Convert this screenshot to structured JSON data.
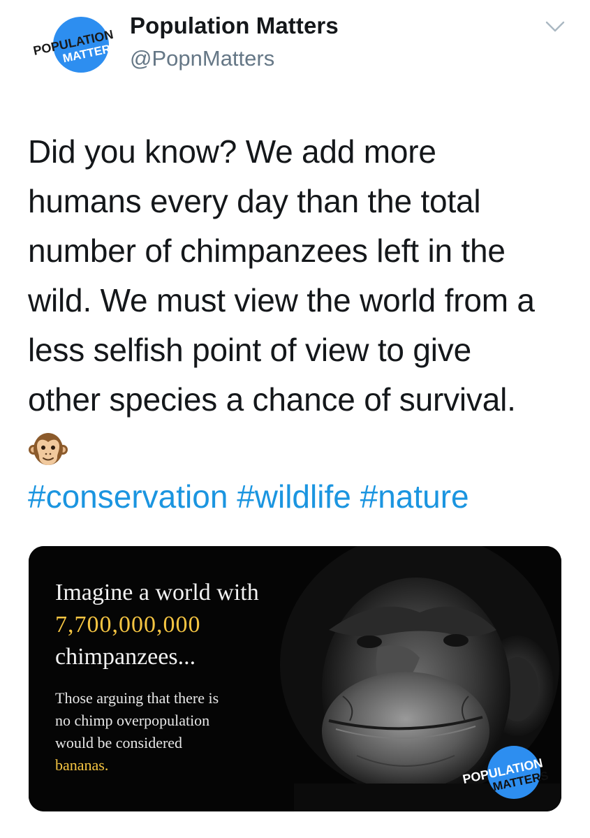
{
  "tweet": {
    "display_name": "Population Matters",
    "handle": "@PopnMatters",
    "avatar_logo": {
      "line1": "POPULATION",
      "line2": "MATTERS"
    },
    "body_lines": [
      "Did you know? We add more",
      "humans every day than the total",
      "number of chimpanzees left in the",
      "wild. We must view the world from a",
      "less selfish point of view to give",
      "other species a chance of survival."
    ],
    "emoji_icon": "monkey-face-icon",
    "hashtags": [
      "#conservation",
      "#wildlife",
      "#nature"
    ]
  },
  "media": {
    "headline_1": "Imagine a world with",
    "number": "7,700,000,000",
    "headline_2": "chimpanzees...",
    "sub_lines": [
      "Those arguing that there is",
      "no chimp overpopulation",
      "would be considered"
    ],
    "highlight": "bananas.",
    "logo": {
      "line1": "POPULATION",
      "line2": "MATTERS"
    }
  },
  "colors": {
    "link": "#1b95e0",
    "brand_blue": "#2d8ef0",
    "accent_yellow": "#f5c542",
    "secondary_text": "#657786"
  }
}
